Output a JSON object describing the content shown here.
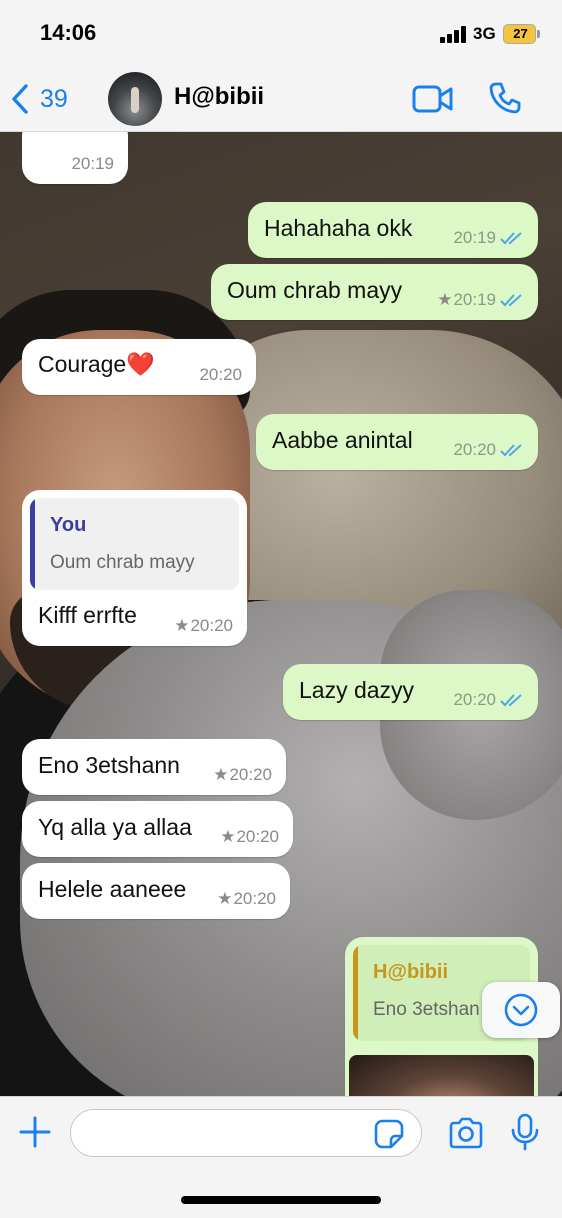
{
  "status_bar": {
    "time": "14:06",
    "network": "3G",
    "battery": "27"
  },
  "header": {
    "back_count": "39",
    "contact_name": "H@bibii"
  },
  "messages": [
    {
      "direction": "in",
      "text": "",
      "time": "20:19",
      "starred": false
    },
    {
      "direction": "out",
      "text": "Hahahaha okk",
      "time": "20:19",
      "starred": false,
      "read": true
    },
    {
      "direction": "out",
      "text": "Oum chrab mayy",
      "time": "20:19",
      "starred": true,
      "read": true
    },
    {
      "direction": "in",
      "text": "Courage❤️",
      "time": "20:20",
      "starred": false
    },
    {
      "direction": "out",
      "text": "Aabbe anintal",
      "time": "20:20",
      "starred": false,
      "read": true
    },
    {
      "direction": "in",
      "text": "Kifff errfte",
      "time": "20:20",
      "starred": true,
      "quote": {
        "author": "You",
        "text": "Oum chrab mayy"
      }
    },
    {
      "direction": "out",
      "text": "Lazy dazyy",
      "time": "20:20",
      "starred": false,
      "read": true
    },
    {
      "direction": "in",
      "text": "Eno 3etshann",
      "time": "20:20",
      "starred": true
    },
    {
      "direction": "in",
      "text": "Yq alla ya allaa",
      "time": "20:20",
      "starred": true
    },
    {
      "direction": "in",
      "text": "Helele aaneee",
      "time": "20:20",
      "starred": true
    },
    {
      "direction": "out",
      "text": "",
      "time": "",
      "starred": false,
      "quote": {
        "author": "H@bibii",
        "text": "Eno 3etshan"
      }
    }
  ],
  "composer": {
    "input_value": "",
    "placeholder": ""
  },
  "icons": {
    "back": "chevron-left-icon",
    "video": "video-camera-icon",
    "call": "phone-icon",
    "plus": "plus-icon",
    "sticker": "sticker-icon",
    "camera": "camera-icon",
    "mic": "microphone-icon",
    "scroll": "chevron-down-circle-icon",
    "read": "double-check-icon",
    "star": "star-icon"
  },
  "colors": {
    "accent": "#1a80f0",
    "incoming_bubble": "#ffffff",
    "outgoing_bubble": "#dcf8c6",
    "read_ticks": "#4fa6e8",
    "quote_self": "#3a3f9e",
    "quote_contact": "#c8961a"
  }
}
